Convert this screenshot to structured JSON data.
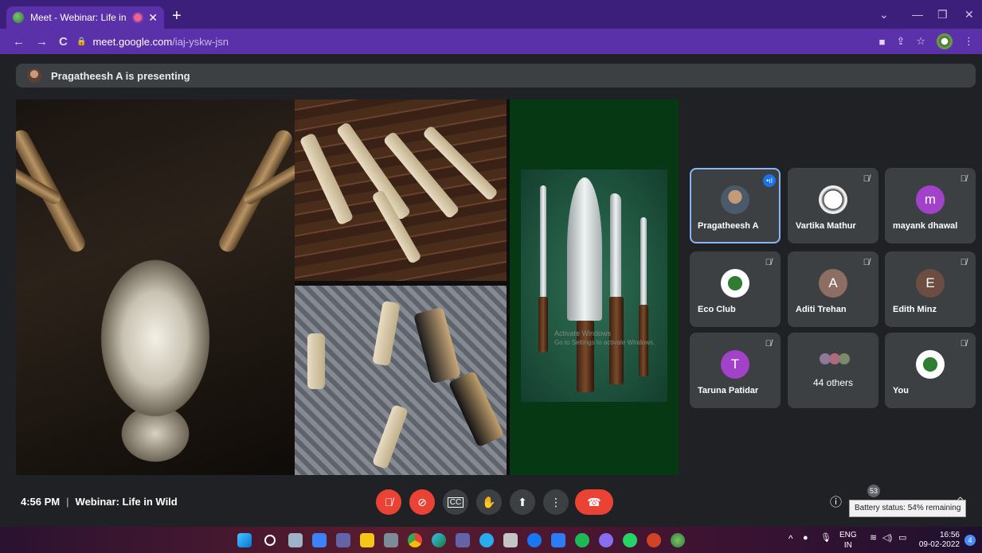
{
  "browser": {
    "tab_title": "Meet - Webinar: Life in Wild",
    "url_host": "meet.google.com",
    "url_path": "/iaj-yskw-jsn"
  },
  "meet": {
    "presenting_text": "Pragatheesh A is presenting",
    "slide_watermark_line1": "Activate Windows",
    "slide_watermark_line2": "Go to Settings to activate Windows.",
    "participants": [
      {
        "name": "Pragatheesh A",
        "initial": "",
        "avatar_color": "#5f6368",
        "speaking": true
      },
      {
        "name": "Vartika Mathur",
        "initial": "",
        "avatar_color": "#e8e8e8",
        "speaking": false
      },
      {
        "name": "mayank dhawal",
        "initial": "m",
        "avatar_color": "#a142c8",
        "speaking": false
      },
      {
        "name": "Eco Club",
        "initial": "",
        "avatar_color": "#ffffff",
        "speaking": false
      },
      {
        "name": "Aditi Trehan",
        "initial": "A",
        "avatar_color": "#8d6e63",
        "speaking": false
      },
      {
        "name": "Edith Minz",
        "initial": "E",
        "avatar_color": "#6d4c41",
        "speaking": false
      },
      {
        "name": "Taruna Patidar",
        "initial": "T",
        "avatar_color": "#a142c8",
        "speaking": false
      },
      {
        "name": "You",
        "initial": "",
        "avatar_color": "#ffffff",
        "speaking": false
      }
    ],
    "others_label": "44 others",
    "time": "4:56 PM",
    "meeting_title": "Webinar: Life in Wild",
    "people_count": "53",
    "tooltip": "Battery status: 54% remaining"
  },
  "taskbar": {
    "lang_line1": "ENG",
    "lang_line2": "IN",
    "clock_time": "16:56",
    "clock_date": "09-02-2022",
    "notif_count": "4"
  },
  "colors": {
    "accent": "#8ab4f8",
    "end_call": "#ea4335",
    "chrome": "#5a31a8"
  }
}
